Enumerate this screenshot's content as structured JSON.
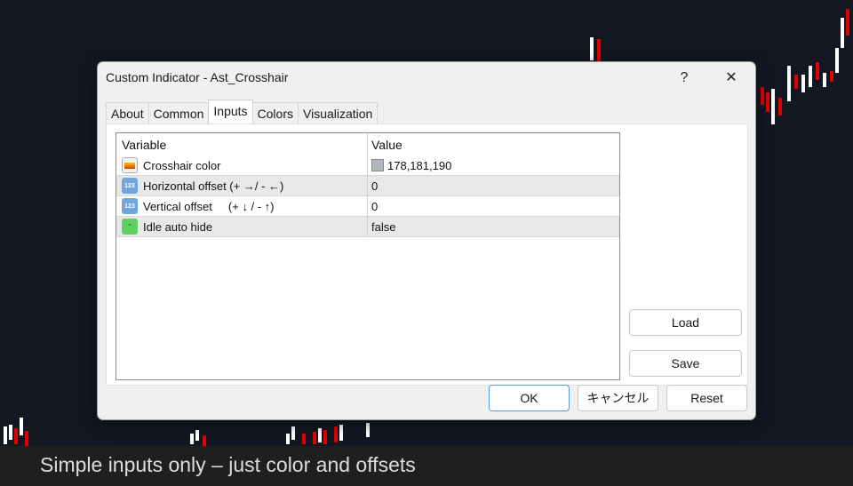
{
  "dialog": {
    "title": "Custom Indicator - Ast_Crosshair",
    "help_label": "?",
    "close_label": "✕"
  },
  "tabs": [
    {
      "label": "About"
    },
    {
      "label": "Common"
    },
    {
      "label": "Inputs"
    },
    {
      "label": "Colors"
    },
    {
      "label": "Visualization"
    }
  ],
  "table": {
    "headers": {
      "variable": "Variable",
      "value": "Value"
    },
    "rows": [
      {
        "variable": "Crosshair color",
        "value": "178,181,190",
        "type": "color",
        "swatch": "#b2b5be"
      },
      {
        "variable": "Horizontal offset (+ →/ - ←)",
        "value": "0",
        "type": "number"
      },
      {
        "variable": "Vertical offset     (+ ↓ / - ↑)",
        "value": "0",
        "type": "number"
      },
      {
        "variable": "Idle auto hide",
        "value": "false",
        "type": "bool"
      }
    ]
  },
  "icons": {
    "number": "123"
  },
  "buttons": {
    "load": "Load",
    "save": "Save",
    "ok": "OK",
    "cancel": "キャンセル",
    "reset": "Reset"
  },
  "caption": "Simple inputs only – just color and offsets",
  "colors": {
    "chart_bg": "#131722",
    "bull": "#ffffff",
    "bear": "#e00000"
  }
}
